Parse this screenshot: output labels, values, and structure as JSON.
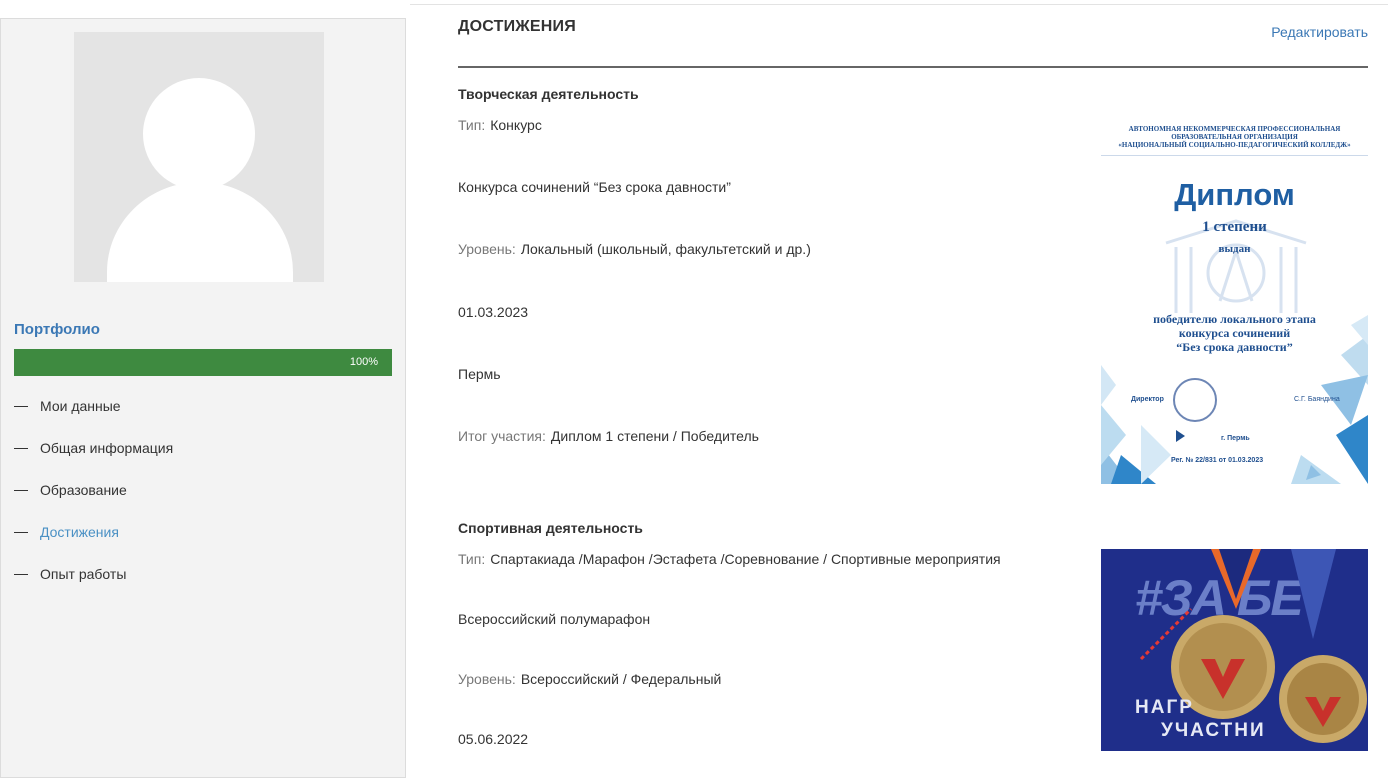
{
  "sidebar": {
    "portfolio_title": "Портфолио",
    "progress": {
      "percent": 100,
      "label": "100%",
      "color": "#3e8a40"
    },
    "menu": [
      {
        "label": "Мои данные",
        "active": false
      },
      {
        "label": "Общая информация",
        "active": false
      },
      {
        "label": "Образование",
        "active": false
      },
      {
        "label": "Достижения",
        "active": true
      },
      {
        "label": "Опыт работы",
        "active": false
      }
    ]
  },
  "main": {
    "title": "ДОСТИЖЕНИЯ",
    "edit_label": "Редактировать",
    "sections": [
      {
        "title": "Творческая деятельность",
        "type_label": "Тип:",
        "type_value": "Конкурс",
        "name": "Конкурса сочинений “Без срока давности”",
        "level_label": "Уровень:",
        "level_value": "Локальный (школьный, факультетский и др.)",
        "date": "01.03.2023",
        "city": "Пермь",
        "result_label": "Итог участия:",
        "result_value": "Диплом 1 степени / Победитель",
        "image": {
          "org": "АВТОНОМНАЯ НЕКОММЕРЧЕСКАЯ ПРОФЕССИОНАЛЬНАЯ",
          "org2": "ОБРАЗОВАТЕЛЬНАЯ ОРГАНИЗАЦИЯ",
          "org3": "«НАЦИОНАЛЬНЫЙ СОЦИАЛЬНО-ПЕДАГОГИЧЕСКИЙ КОЛЛЕДЖ»",
          "title": "Диплом",
          "degree": "1 степени",
          "issued": "выдан",
          "text1": "победителю локального этапа",
          "text2": "конкурса сочинений",
          "text3": "“Без срока давности”",
          "director": "Директор",
          "signature": "С.Г. Баяндина",
          "city": "г. Пермь",
          "reg": "Рег. №   22/831 от 01.03.2023"
        }
      },
      {
        "title": "Спортивная деятельность",
        "type_label": "Тип:",
        "type_value": "Спартакиада /Марафон /Эстафета /Соревнование / Спортивные мероприятия",
        "name": "Всероссийский полумарафон",
        "level_label": "Уровень:",
        "level_value": "Всероссийский / Федеральный",
        "date": "05.06.2022",
        "image": {
          "hashtag": "#ЗА БЕ",
          "award": "НАГР",
          "participants": "УЧАСТНИ"
        }
      }
    ]
  }
}
